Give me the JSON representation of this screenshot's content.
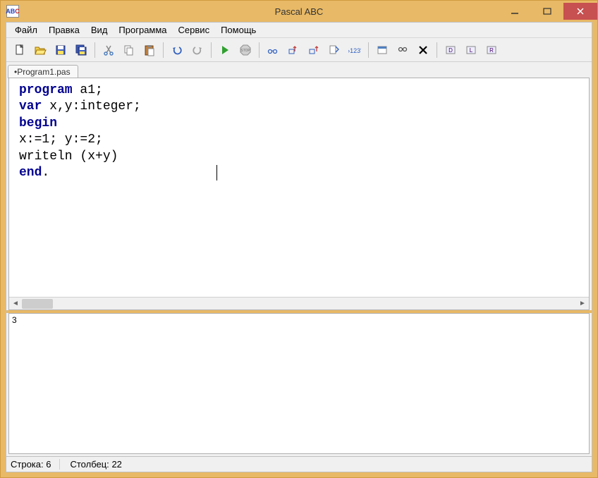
{
  "window": {
    "title": "Pascal ABC",
    "icon_text_a": "AB",
    "icon_text_b": "C"
  },
  "menu": {
    "file": "Файл",
    "edit": "Правка",
    "view": "Вид",
    "program": "Программа",
    "service": "Сервис",
    "help": "Помощь"
  },
  "toolbar": {
    "new": "new-file",
    "open": "open-file",
    "save": "save-file",
    "save_all": "save-all",
    "cut": "cut",
    "copy": "copy",
    "paste": "paste",
    "undo": "undo",
    "redo": "redo",
    "run": "run",
    "stop": "stop",
    "trace_into": "trace-into",
    "step_over": "step-over",
    "step_out": "step-out",
    "breakpoint": "toggle-breakpoint",
    "eval": "evaluate",
    "new_window": "new-window",
    "find": "find",
    "delete": "delete",
    "db1": "declarations",
    "db2": "locals",
    "db3": "watches"
  },
  "tab": {
    "label": "•Program1.pas"
  },
  "code": {
    "line1_kw": "program",
    "line1_rest": " a1;",
    "line2_kw": "var",
    "line2_rest": " x,y:integer;",
    "line3_kw": "begin",
    "line4": "x:=1; y:=2;",
    "line5": "writeln (x+y)",
    "line6_kw": "end",
    "line6_rest": "."
  },
  "output": {
    "text": "3"
  },
  "status": {
    "line_label": "Строка:",
    "line_value": "6",
    "col_label": "Столбец:",
    "col_value": "22"
  }
}
